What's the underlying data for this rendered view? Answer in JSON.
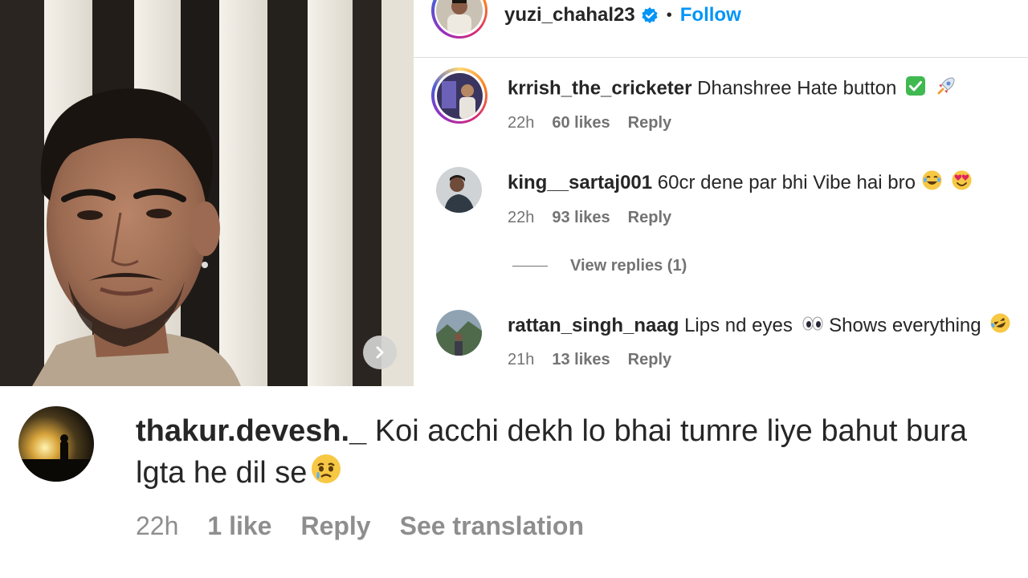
{
  "post": {
    "next_button_label": "Next"
  },
  "header": {
    "username": "yuzi_chahal23",
    "separator": "•",
    "follow_label": "Follow"
  },
  "comments": [
    {
      "username": "krrish_the_cricketer",
      "text": "Dhanshree Hate button",
      "emojis": [
        "check-mark-emoji",
        "rocket-emoji"
      ],
      "time": "22h",
      "likes": "60 likes",
      "reply_label": "Reply",
      "has_story_ring": true
    },
    {
      "username": "king__sartaj001",
      "text": "60cr dene par bhi Vibe hai bro",
      "emojis": [
        "laughing-tears-emoji",
        "heart-eyes-emoji"
      ],
      "time": "22h",
      "likes": "93 likes",
      "reply_label": "Reply",
      "has_story_ring": false,
      "view_replies_label": "View replies (1)"
    },
    {
      "username": "rattan_singh_naag",
      "text": "Lips nd eyes",
      "text_after_emoji": "Shows everything",
      "emojis": [
        "eyes-emoji",
        "rolling-laughing-emoji"
      ],
      "time": "21h",
      "likes": "13 likes",
      "reply_label": "Reply",
      "has_story_ring": false
    }
  ],
  "featured_comment": {
    "username": "thakur.devesh._",
    "text": "Koi acchi dekh lo bhai tumre liye bahut bura lgta he dil se",
    "emoji": "crying-face-emoji",
    "time": "22h",
    "likes": "1 like",
    "reply_label": "Reply",
    "translation_label": "See translation"
  },
  "colors": {
    "accent": "#0095f6",
    "secondary_text": "#737373",
    "primary_text": "#262626",
    "verified": "#0095f6"
  }
}
